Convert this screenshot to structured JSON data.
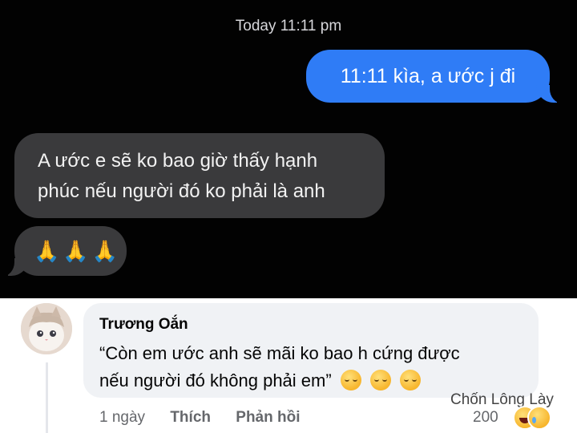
{
  "messages_screenshot": {
    "timestamp": "Today 11:11 pm",
    "outgoing": "11:11 kìa, a ước j đi",
    "incoming": [
      {
        "line1": "A ước e sẽ ko bao giờ thấy hạnh",
        "line2": "phúc nếu người đó ko phải là anh"
      },
      {
        "emoji": "🙏🙏🙏"
      }
    ],
    "colors": {
      "background": "#020202",
      "outgoing_bubble": "#2f7cf6",
      "incoming_bubble": "#3a3a3c"
    }
  },
  "comment": {
    "author": "Trương Oắn",
    "text_line1": "“Còn em ước anh sẽ mãi ko bao h cứng được",
    "text_line2": "nếu người đó không phải em”",
    "trailing_emoji": [
      "relieved-face-icon",
      "relieved-face-icon",
      "relieved-face-icon"
    ],
    "time": "1 ngày",
    "like_label": "Thích",
    "reply_label": "Phản hồi",
    "reaction_count": "200",
    "reaction_icons": [
      "haha-icon",
      "sad-icon"
    ]
  },
  "watermark": "Chốn Lông Lày"
}
